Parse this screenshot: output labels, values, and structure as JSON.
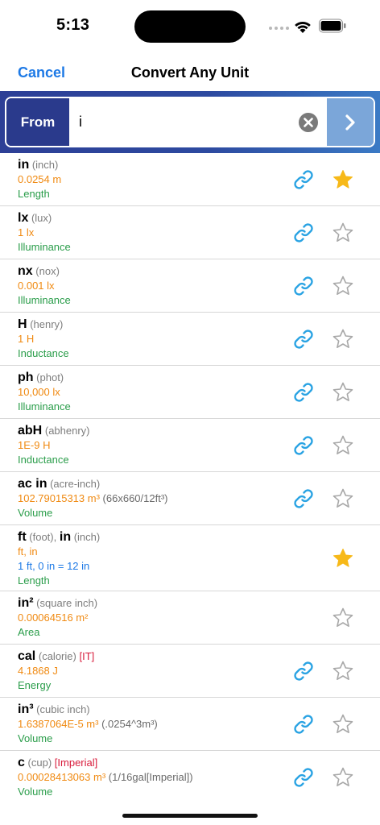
{
  "status": {
    "time": "5:13"
  },
  "nav": {
    "cancel_label": "Cancel",
    "title": "Convert Any Unit"
  },
  "search": {
    "from_label": "From",
    "value": "i",
    "placeholder": ""
  },
  "units": [
    {
      "symbol": "in",
      "name": "(inch)",
      "value": "0.0254 m",
      "category": "Length",
      "linked": true,
      "starred": true
    },
    {
      "symbol": "lx",
      "name": "(lux)",
      "value": "1 lx",
      "category": "Illuminance",
      "linked": true,
      "starred": false
    },
    {
      "symbol": "nx",
      "name": "(nox)",
      "value": "0.001 lx",
      "category": "Illuminance",
      "linked": true,
      "starred": false
    },
    {
      "symbol": "H",
      "name": "(henry)",
      "value": "1 H",
      "category": "Inductance",
      "linked": true,
      "starred": false
    },
    {
      "symbol": "ph",
      "name": "(phot)",
      "value": "10,000 lx",
      "category": "Illuminance",
      "linked": true,
      "starred": false
    },
    {
      "symbol": "abH",
      "name": "(abhenry)",
      "value": "1E-9 H",
      "category": "Inductance",
      "linked": true,
      "starred": false
    },
    {
      "symbol": "ac in",
      "name": "(acre-inch)",
      "value": "102.79015313 m³",
      "note": "(66x660/12ft³)",
      "category": "Volume",
      "linked": true,
      "starred": false
    },
    {
      "symbol": "ft",
      "name": "(foot),",
      "symbol2": "in",
      "name2": "(inch)",
      "value": "ft, in",
      "blue": "1 ft, 0 in = 12 in",
      "category": "Length",
      "linked": false,
      "starred": true
    },
    {
      "symbol": "in²",
      "name": "(square inch)",
      "value": "0.00064516 m²",
      "category": "Area",
      "linked": false,
      "starred": false
    },
    {
      "symbol": "cal",
      "name": "(calorie)",
      "tag": "[IT]",
      "value": "4.1868 J",
      "category": "Energy",
      "linked": true,
      "starred": false
    },
    {
      "symbol": "in³",
      "name": "(cubic inch)",
      "value": "1.6387064E-5 m³",
      "note": "(.0254^3m³)",
      "category": "Volume",
      "linked": true,
      "starred": false
    },
    {
      "symbol": "c",
      "name": "(cup)",
      "tag": "[Imperial]",
      "value": "0.00028413063 m³",
      "note": "(1/16gal[Imperial])",
      "category": "Volume",
      "linked": true,
      "starred": false
    }
  ],
  "colors": {
    "accent": "#1e7ae6",
    "value": "#f08a12",
    "category": "#2a9d4a",
    "star": "#f7b919",
    "link": "#2aa3e3"
  }
}
